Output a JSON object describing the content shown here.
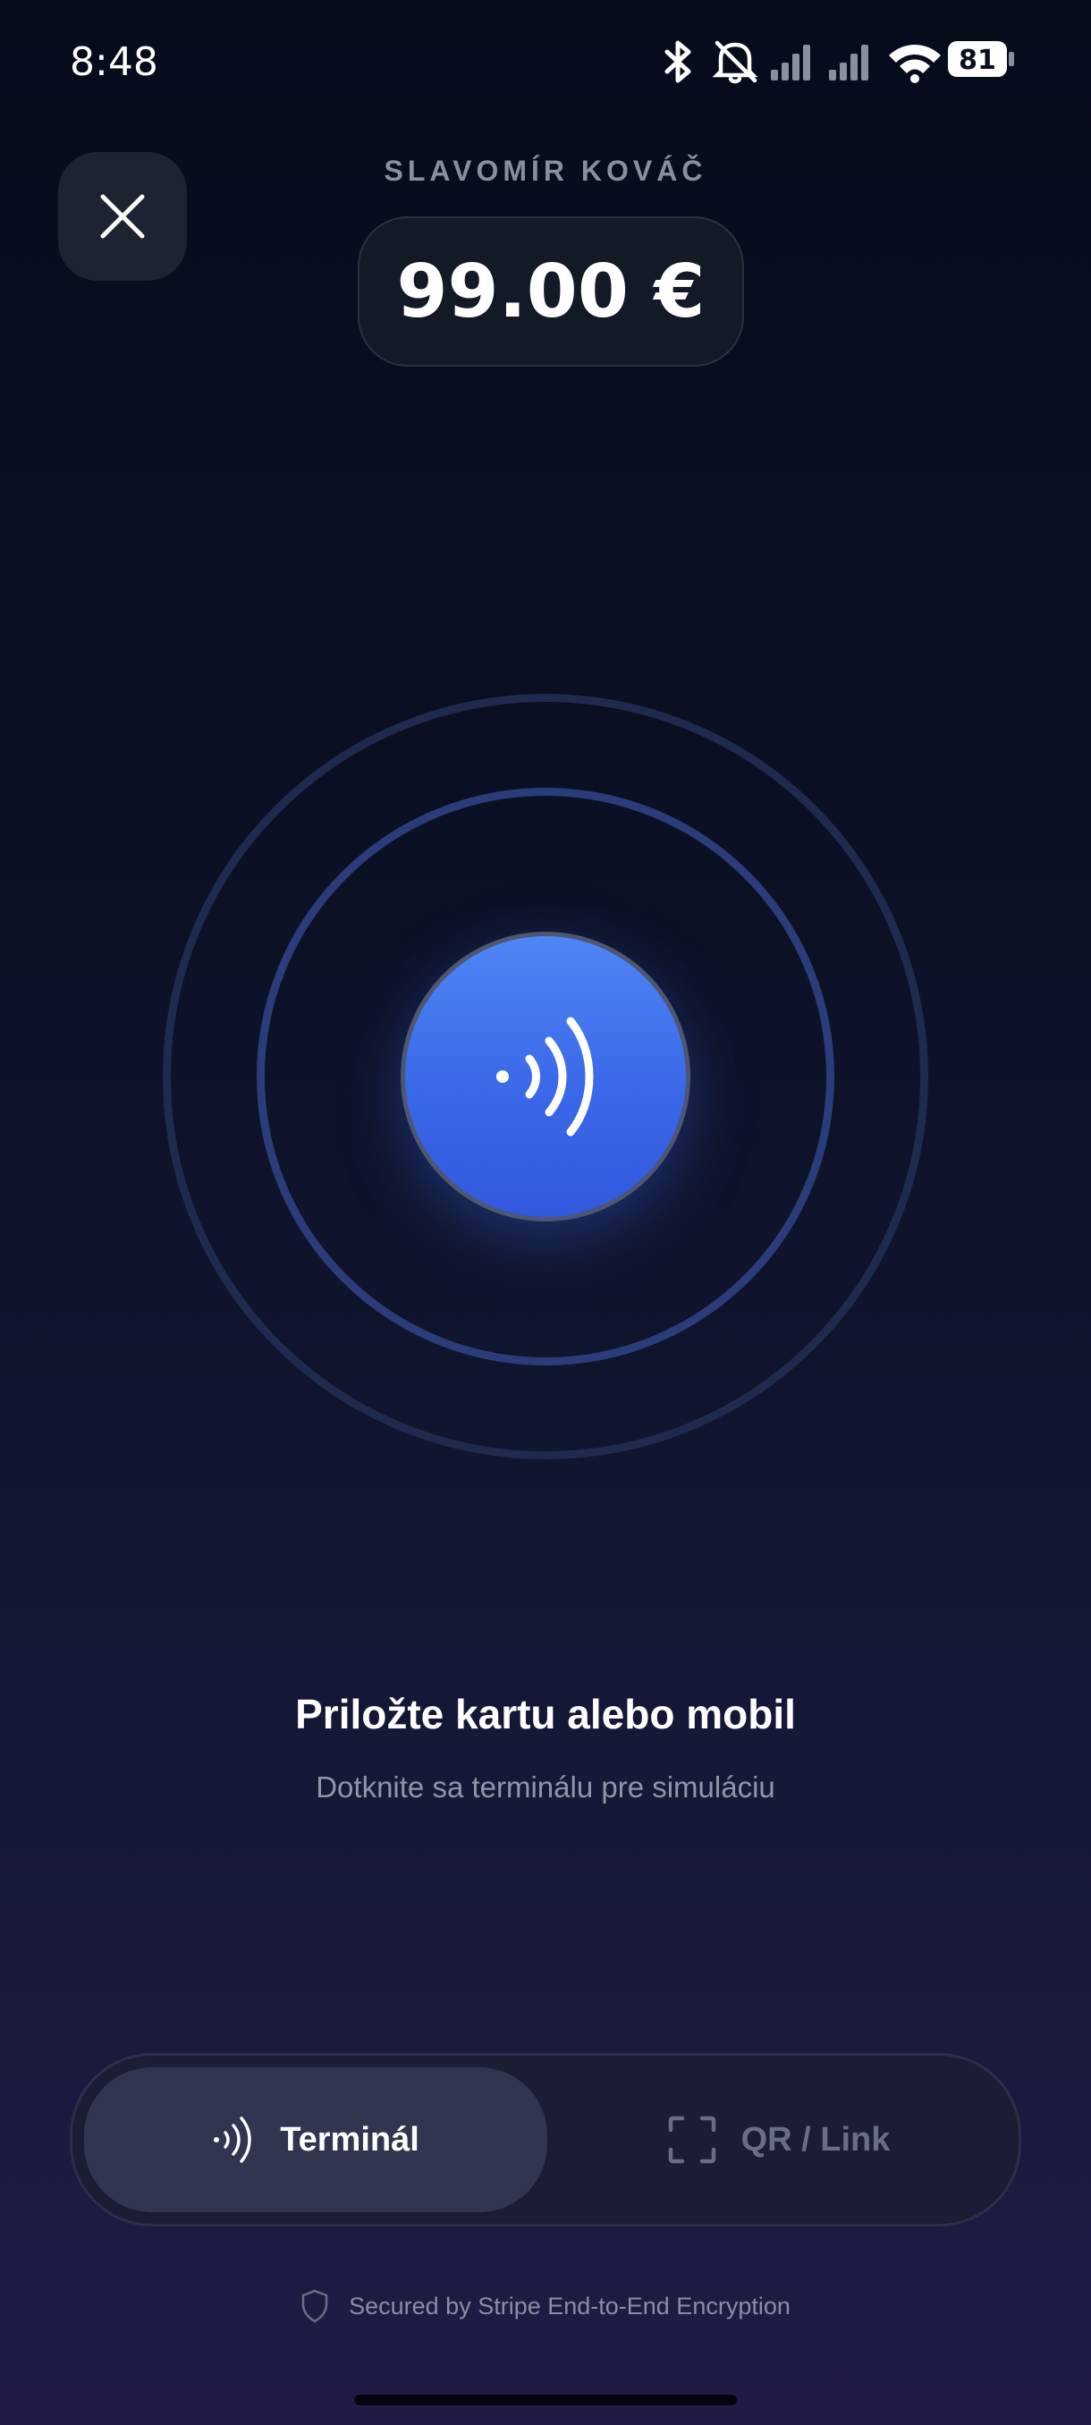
{
  "status_bar": {
    "time": "8:48",
    "battery": "81",
    "icons": [
      "bluetooth-icon",
      "muted-bell-icon",
      "signal-icon",
      "signal-icon",
      "wifi-icon",
      "battery-icon"
    ]
  },
  "header": {
    "close_icon": "close-icon",
    "merchant_name": "SLAVOMÍR KOVÁČ",
    "amount": "99.00 €"
  },
  "nfc": {
    "icon": "contactless-icon",
    "accent_color": "#3f72ec"
  },
  "prompt": {
    "title": "Priložte kartu alebo mobil",
    "subtitle": "Dotknite sa terminálu pre simuláciu"
  },
  "mode_switch": {
    "options": [
      {
        "label": "Terminál",
        "icon": "contactless-icon",
        "selected": true
      },
      {
        "label": "QR / Link",
        "icon": "qr-scan-icon",
        "selected": false
      }
    ]
  },
  "footer": {
    "security_icon": "shield-icon",
    "security_text": "Secured by Stripe End-to-End Encryption"
  }
}
